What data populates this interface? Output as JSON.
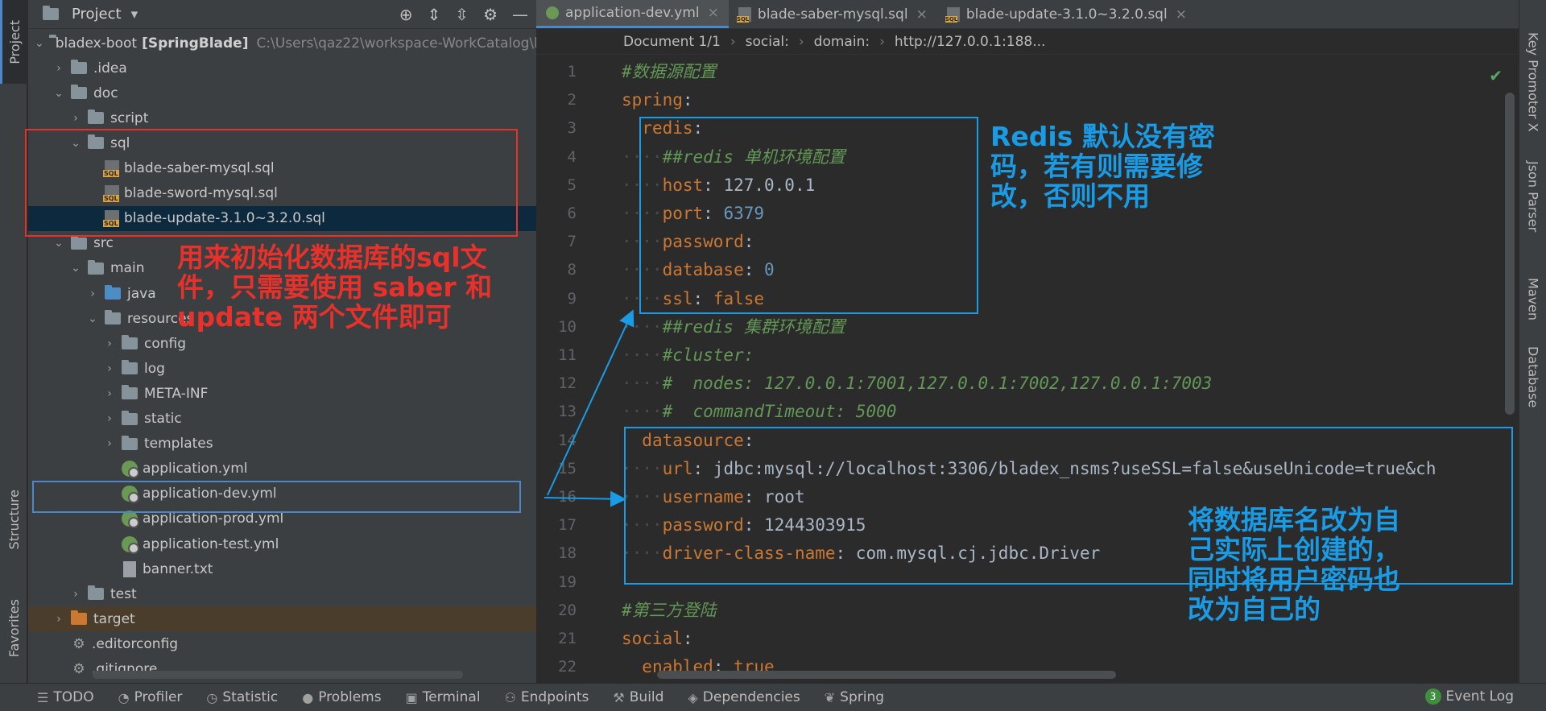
{
  "left_strip": {
    "project": "Project",
    "structure": "Structure",
    "favorites": "Favorites"
  },
  "project_panel": {
    "title": "Project",
    "tree": [
      {
        "label": "bladex-boot",
        "bold": "[SpringBlade]",
        "hint": "C:\\Users\\qaz22\\workspace-WorkCatalog\\b"
      },
      {
        "label": ".idea"
      },
      {
        "label": "doc"
      },
      {
        "label": "script"
      },
      {
        "label": "sql"
      },
      {
        "label": "blade-saber-mysql.sql"
      },
      {
        "label": "blade-sword-mysql.sql"
      },
      {
        "label": "blade-update-3.1.0~3.2.0.sql"
      },
      {
        "label": "src"
      },
      {
        "label": "main"
      },
      {
        "label": "java"
      },
      {
        "label": "resources"
      },
      {
        "label": "config"
      },
      {
        "label": "log"
      },
      {
        "label": "META-INF"
      },
      {
        "label": "static"
      },
      {
        "label": "templates"
      },
      {
        "label": "application.yml"
      },
      {
        "label": "application-dev.yml"
      },
      {
        "label": "application-prod.yml"
      },
      {
        "label": "application-test.yml"
      },
      {
        "label": "banner.txt"
      },
      {
        "label": "test"
      },
      {
        "label": "target"
      },
      {
        "label": ".editorconfig"
      },
      {
        "label": ".gitignore"
      }
    ]
  },
  "editor": {
    "tabs": [
      {
        "label": "application-dev.yml",
        "active": true
      },
      {
        "label": "blade-saber-mysql.sql"
      },
      {
        "label": "blade-update-3.1.0~3.2.0.sql"
      }
    ],
    "breadcrumb": [
      "Document 1/1",
      "social:",
      "domain:",
      "http://127.0.0.1:188..."
    ],
    "lines": [
      {
        "n": "1",
        "c": [
          [
            "cmt",
            "#数据源配置"
          ]
        ]
      },
      {
        "n": "2",
        "c": [
          [
            "key",
            "spring"
          ],
          [
            "val",
            ":"
          ]
        ]
      },
      {
        "n": "3",
        "c": [
          [
            "dot",
            "  "
          ],
          [
            "key",
            "redis"
          ],
          [
            "val",
            ":"
          ]
        ]
      },
      {
        "n": "4",
        "c": [
          [
            "dot",
            "····"
          ],
          [
            "cmt",
            "##redis 单机环境配置"
          ]
        ]
      },
      {
        "n": "5",
        "c": [
          [
            "dot",
            "····"
          ],
          [
            "key",
            "host"
          ],
          [
            "val",
            ": 127.0.0.1"
          ]
        ]
      },
      {
        "n": "6",
        "c": [
          [
            "dot",
            "····"
          ],
          [
            "key",
            "port"
          ],
          [
            "val",
            ": "
          ],
          [
            "num",
            "6379"
          ]
        ]
      },
      {
        "n": "7",
        "c": [
          [
            "dot",
            "····"
          ],
          [
            "key",
            "password"
          ],
          [
            "val",
            ":"
          ]
        ]
      },
      {
        "n": "8",
        "c": [
          [
            "dot",
            "····"
          ],
          [
            "key",
            "database"
          ],
          [
            "val",
            ": "
          ],
          [
            "num",
            "0"
          ]
        ]
      },
      {
        "n": "9",
        "c": [
          [
            "dot",
            "····"
          ],
          [
            "key",
            "ssl"
          ],
          [
            "val",
            ": "
          ],
          [
            "kw",
            "false"
          ]
        ]
      },
      {
        "n": "10",
        "c": [
          [
            "dot",
            "····"
          ],
          [
            "cmt",
            "##redis 集群环境配置"
          ]
        ]
      },
      {
        "n": "11",
        "c": [
          [
            "dot",
            "····"
          ],
          [
            "cmt",
            "#cluster:"
          ]
        ]
      },
      {
        "n": "12",
        "c": [
          [
            "dot",
            "····"
          ],
          [
            "cmt",
            "#  nodes: 127.0.0.1:7001,127.0.0.1:7002,127.0.0.1:7003"
          ]
        ]
      },
      {
        "n": "13",
        "c": [
          [
            "dot",
            "····"
          ],
          [
            "cmt",
            "#  commandTimeout: 5000"
          ]
        ]
      },
      {
        "n": "14",
        "c": [
          [
            "dot",
            "  "
          ],
          [
            "key",
            "datasource"
          ],
          [
            "val",
            ":"
          ]
        ]
      },
      {
        "n": "15",
        "c": [
          [
            "dot",
            "····"
          ],
          [
            "key",
            "url"
          ],
          [
            "val",
            ": jdbc:mysql://localhost:3306/bladex_nsms?useSSL=false&useUnicode=true&ch"
          ]
        ]
      },
      {
        "n": "16",
        "c": [
          [
            "dot",
            "····"
          ],
          [
            "key",
            "username"
          ],
          [
            "val",
            ": root"
          ]
        ]
      },
      {
        "n": "17",
        "c": [
          [
            "dot",
            "····"
          ],
          [
            "key",
            "password"
          ],
          [
            "val",
            ": 1244303915"
          ]
        ]
      },
      {
        "n": "18",
        "c": [
          [
            "dot",
            "····"
          ],
          [
            "key",
            "driver-class-name"
          ],
          [
            "val",
            ": com.mysql.cj.jdbc.Driver"
          ]
        ]
      },
      {
        "n": "19",
        "c": []
      },
      {
        "n": "20",
        "c": [
          [
            "cmt",
            "#第三方登陆"
          ]
        ]
      },
      {
        "n": "21",
        "c": [
          [
            "key",
            "social"
          ],
          [
            "val",
            ":"
          ]
        ]
      },
      {
        "n": "22",
        "c": [
          [
            "dot",
            "  "
          ],
          [
            "key",
            "enabled"
          ],
          [
            "val",
            ": "
          ],
          [
            "kw",
            "true"
          ]
        ]
      }
    ]
  },
  "right_strip": [
    "Key Promoter X",
    "Json Parser",
    "Maven",
    "Database"
  ],
  "bottom_bar": {
    "tabs": [
      "TODO",
      "Profiler",
      "Statistic",
      "Problems",
      "Terminal",
      "Endpoints",
      "Build",
      "Dependencies",
      "Spring"
    ],
    "event_log": "Event Log",
    "event_count": "3"
  },
  "annotations": {
    "sql_note": "用来初始化数据库的sql文\n件，只需要使用 saber 和\nupdate 两个文件即可",
    "redis_note": "Redis 默认没有密\n码，若有则需要修\n改，否则不用",
    "datasource_note": "将数据库名改为自\n己实际上创建的，\n同时将用户密码也\n改为自己的"
  },
  "colors": {
    "annotation_red": "#e8312a",
    "annotation_blue": "#1a9be6",
    "accent": "#4a88c7"
  }
}
